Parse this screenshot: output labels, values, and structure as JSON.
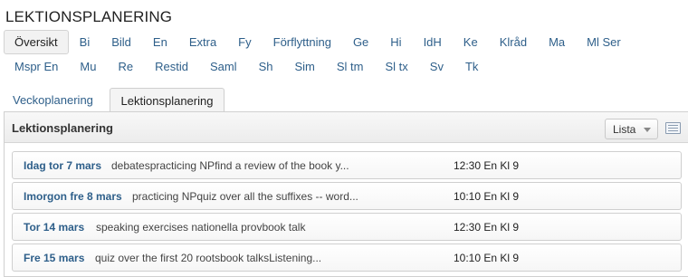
{
  "page": {
    "title": "LEKTIONSPLANERING"
  },
  "subjects": {
    "row1": [
      "Översikt",
      "Bi",
      "Bild",
      "En",
      "Extra",
      "Fy",
      "Förflyttning",
      "Ge",
      "Hi",
      "IdH",
      "Ke",
      "Klråd",
      "Ma",
      "Ml Ser"
    ],
    "row2": [
      "Mspr En",
      "Mu",
      "Re",
      "Restid",
      "Saml",
      "Sh",
      "Sim",
      "Sl tm",
      "Sl tx",
      "Sv",
      "Tk"
    ],
    "active": "Översikt"
  },
  "tabs": [
    "Veckoplanering",
    "Lektionsplanering"
  ],
  "active_tab": "Lektionsplanering",
  "panel": {
    "title": "Lektionsplanering",
    "view_select": "Lista"
  },
  "lessons": [
    {
      "date": "Idag tor 7 mars",
      "desc": "debatespracticing NPfind a review of the book y...",
      "info": "12:30 En Kl 9"
    },
    {
      "date": "Imorgon fre 8 mars",
      "desc": "practicing NPquiz over all the suffixes -- word...",
      "info": "10:10 En Kl 9"
    },
    {
      "date": "Tor 14 mars",
      "desc": "speaking exercises nationella provbook talk",
      "info": "12:30 En Kl 9"
    },
    {
      "date": "Fre 15 mars",
      "desc": "quiz over the first 20 rootsbook talksListening...",
      "info": "10:10 En Kl 9"
    }
  ]
}
